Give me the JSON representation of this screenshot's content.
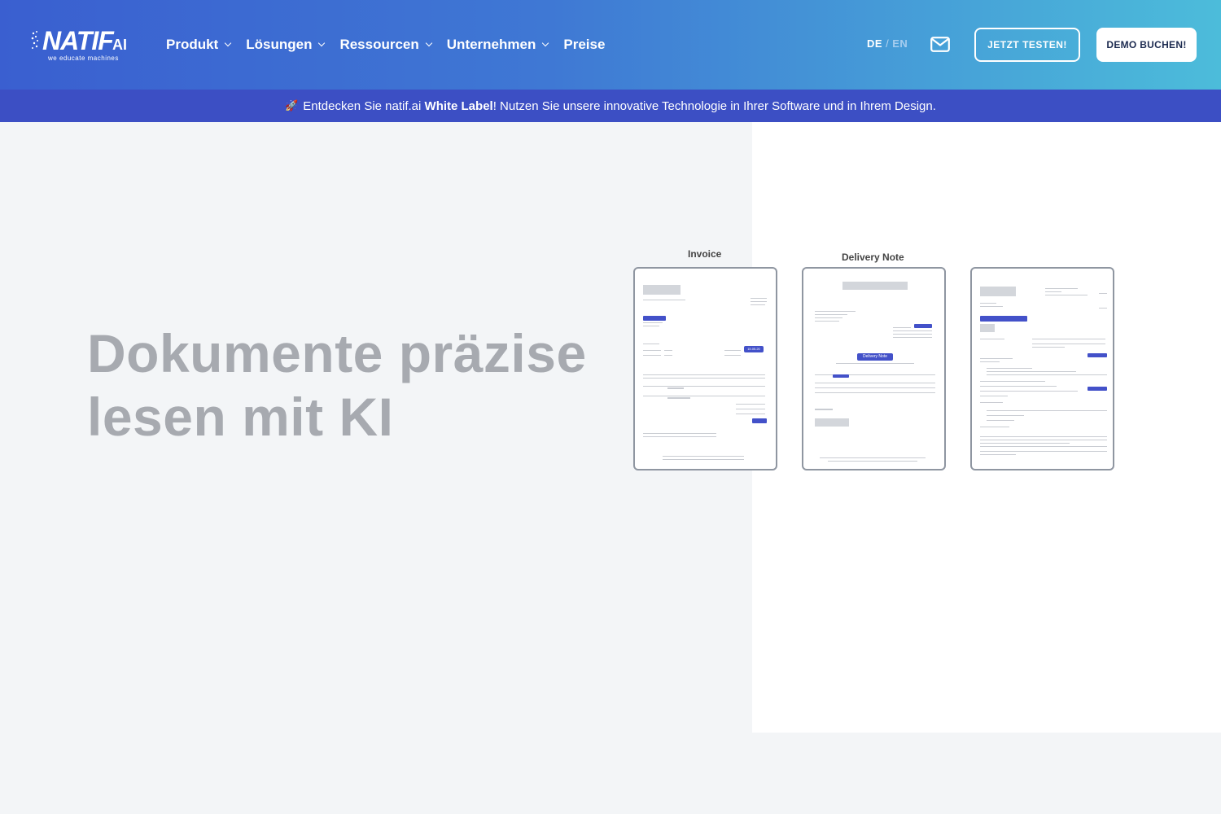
{
  "header": {
    "logo": {
      "name": "NATIF",
      "suffix": "AI",
      "tagline": "we educate machines"
    },
    "nav": [
      {
        "label": "Produkt",
        "has_dropdown": true
      },
      {
        "label": "Lösungen",
        "has_dropdown": true
      },
      {
        "label": "Ressourcen",
        "has_dropdown": true
      },
      {
        "label": "Unternehmen",
        "has_dropdown": true
      },
      {
        "label": "Preise",
        "has_dropdown": false
      }
    ],
    "lang": {
      "active": "DE",
      "separator": "/",
      "other": "EN"
    },
    "mail_icon": "envelope-icon",
    "cta_outline": "JETZT TESTEN!",
    "cta_solid": "DEMO BUCHEN!"
  },
  "banner": {
    "icon": "rocket-icon",
    "text_before": "Entdecken Sie natif.ai",
    "text_bold": "White Label",
    "text_after": "! Nutzen Sie unsere innovative Technologie in Ihrer Software und in Ihrem Design."
  },
  "hero": {
    "title_line1": "Dokumente präzise",
    "title_line2": "lesen mit KI"
  },
  "documents": [
    {
      "label": "Invoice",
      "date_tag": "15.05.20"
    },
    {
      "label": "Delivery Note",
      "tag": "Delivery Note"
    },
    {
      "label": ""
    }
  ],
  "colors": {
    "header_gradient_start": "#3a5fd0",
    "header_gradient_end": "#4cbcda",
    "banner": "#3c4fc4",
    "highlight": "#4351c9",
    "hero_title": "#a7aab0"
  }
}
